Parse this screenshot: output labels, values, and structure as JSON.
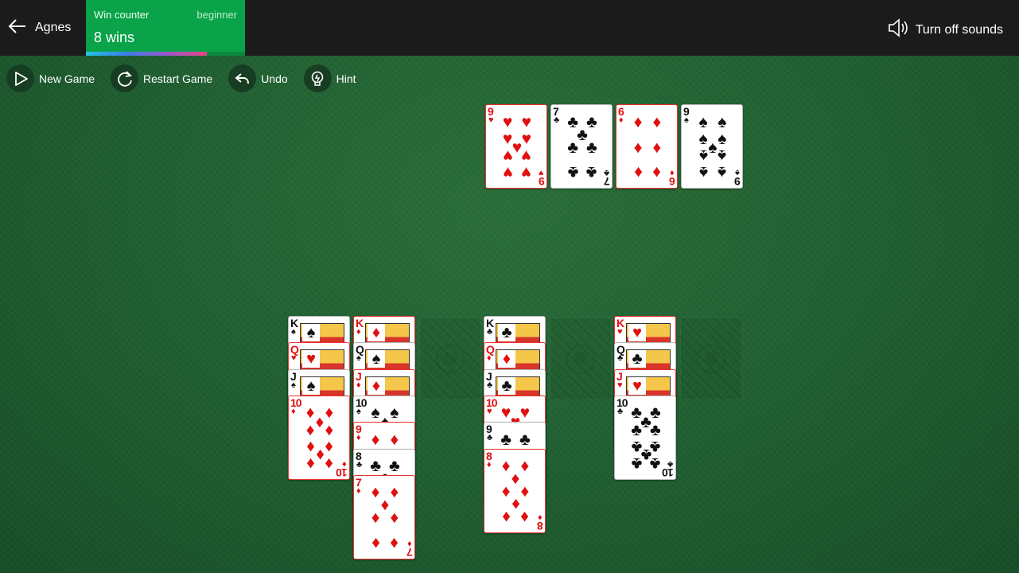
{
  "topbar": {
    "back_label": "Agnes",
    "win_counter": {
      "title": "Win counter",
      "level": "beginner",
      "wins": "8 wins",
      "progress": 0.76
    },
    "sound_label": "Turn off sounds"
  },
  "toolbar": {
    "new_game": "New Game",
    "restart": "Restart Game",
    "undo": "Undo",
    "hint": "Hint"
  },
  "foundations": [
    {
      "rank": "9",
      "suit": "hearts"
    },
    {
      "rank": "7",
      "suit": "clubs"
    },
    {
      "rank": "6",
      "suit": "diamonds"
    },
    {
      "rank": "9",
      "suit": "spades"
    }
  ],
  "tableau": [
    [
      {
        "rank": "K",
        "suit": "spades"
      },
      {
        "rank": "Q",
        "suit": "hearts"
      },
      {
        "rank": "J",
        "suit": "spades"
      },
      {
        "rank": "10",
        "suit": "diamonds"
      }
    ],
    [
      {
        "rank": "K",
        "suit": "diamonds"
      },
      {
        "rank": "Q",
        "suit": "spades"
      },
      {
        "rank": "J",
        "suit": "diamonds"
      },
      {
        "rank": "10",
        "suit": "spades"
      },
      {
        "rank": "9",
        "suit": "diamonds"
      },
      {
        "rank": "8",
        "suit": "clubs"
      },
      {
        "rank": "7",
        "suit": "diamonds"
      }
    ],
    [],
    [
      {
        "rank": "K",
        "suit": "clubs"
      },
      {
        "rank": "Q",
        "suit": "diamonds"
      },
      {
        "rank": "J",
        "suit": "clubs"
      },
      {
        "rank": "10",
        "suit": "hearts"
      },
      {
        "rank": "9",
        "suit": "clubs"
      },
      {
        "rank": "8",
        "suit": "diamonds"
      }
    ],
    [],
    [
      {
        "rank": "K",
        "suit": "hearts"
      },
      {
        "rank": "Q",
        "suit": "clubs"
      },
      {
        "rank": "J",
        "suit": "hearts"
      },
      {
        "rank": "10",
        "suit": "clubs"
      }
    ],
    []
  ],
  "colors": {
    "felt": "#1f5e30",
    "win_counter": "#0aa34a",
    "topbar": "#1b1b1b",
    "red_suit": "#e01010"
  }
}
